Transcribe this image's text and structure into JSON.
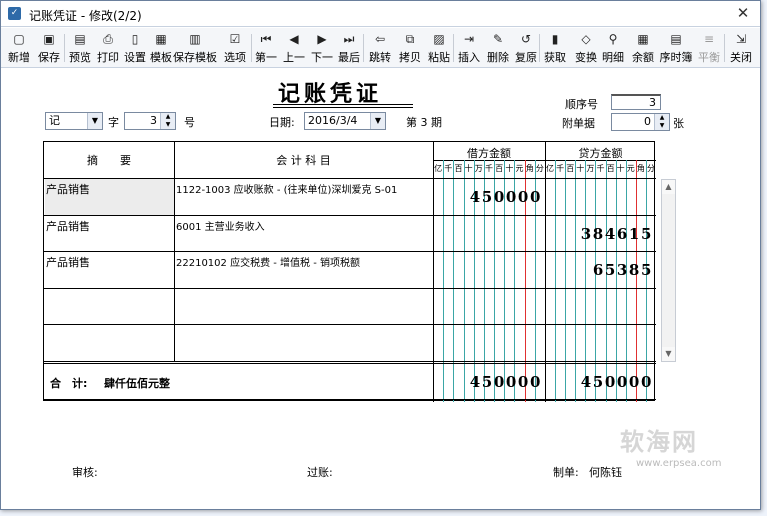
{
  "window": {
    "title": "记账凭证 - 修改(2/2)",
    "close_glyph": "✕"
  },
  "toolbar": {
    "buttons": [
      {
        "label": "新增",
        "icon": "new-icon",
        "glyph": "▢"
      },
      {
        "label": "保存",
        "icon": "save-icon",
        "glyph": "▣"
      },
      {
        "label": "预览",
        "icon": "preview-icon",
        "glyph": "▤"
      },
      {
        "label": "打印",
        "icon": "print-icon",
        "glyph": "⎙"
      },
      {
        "label": "设置",
        "icon": "settings-icon",
        "glyph": "▯"
      },
      {
        "label": "模板",
        "icon": "template-icon",
        "glyph": "▦"
      },
      {
        "label": "保存模板",
        "icon": "save-template-icon",
        "glyph": "▥"
      },
      {
        "label": "选项",
        "icon": "options-icon",
        "glyph": "☑"
      },
      {
        "label": "第一",
        "icon": "first-icon",
        "glyph": "⏮"
      },
      {
        "label": "上一",
        "icon": "prev-icon",
        "glyph": "◀"
      },
      {
        "label": "下一",
        "icon": "next-icon",
        "glyph": "▶"
      },
      {
        "label": "最后",
        "icon": "last-icon",
        "glyph": "⏭"
      },
      {
        "label": "跳转",
        "icon": "jump-icon",
        "glyph": "⇦"
      },
      {
        "label": "拷贝",
        "icon": "copy-icon",
        "glyph": "⧉"
      },
      {
        "label": "粘贴",
        "icon": "paste-icon",
        "glyph": "▨"
      },
      {
        "label": "插入",
        "icon": "insert-icon",
        "glyph": "⇥"
      },
      {
        "label": "删除",
        "icon": "delete-icon",
        "glyph": "✎"
      },
      {
        "label": "复原",
        "icon": "restore-icon",
        "glyph": "↺"
      },
      {
        "label": "获取",
        "icon": "fetch-icon",
        "glyph": "▮"
      },
      {
        "label": "变换",
        "icon": "transform-icon",
        "glyph": "◇"
      },
      {
        "label": "明细",
        "icon": "detail-icon",
        "glyph": "⚲"
      },
      {
        "label": "余额",
        "icon": "balance-icon",
        "glyph": "▦"
      },
      {
        "label": "序时簿",
        "icon": "journal-icon",
        "glyph": "▤"
      },
      {
        "label": "平衡",
        "icon": "balance-check-icon",
        "glyph": "≡",
        "disabled": true
      },
      {
        "label": "关闭",
        "icon": "close-doc-icon",
        "glyph": "⇲"
      }
    ]
  },
  "voucher": {
    "title": "记账凭证",
    "word_type": "记",
    "zi_label": "字",
    "number": "3",
    "hao_label": "号",
    "date_label": "日期:",
    "date": "2016/3/4",
    "period": "第 3 期",
    "seq_label": "顺序号",
    "seq": "3",
    "attach_label": "附单据",
    "attach": "0",
    "zhang_label": "张",
    "headers": {
      "summary": "摘　　要",
      "account": "会 计 科 目",
      "debit": "借方金额",
      "credit": "贷方金额",
      "digits": [
        "亿",
        "千",
        "百",
        "十",
        "万",
        "千",
        "百",
        "十",
        "元",
        "角",
        "分"
      ]
    },
    "rows": [
      {
        "summary": "产品销售",
        "account": "1122-1003 应收账款 - (往来单位)深圳爱克 S-01",
        "debit": "450000",
        "credit": ""
      },
      {
        "summary": "产品销售",
        "account": "6001 主营业务收入",
        "debit": "",
        "credit": "384615"
      },
      {
        "summary": "产品销售",
        "account": "22210102 应交税费 - 增值税 - 销项税额",
        "debit": "",
        "credit": "65385"
      },
      {
        "summary": "",
        "account": "",
        "debit": "",
        "credit": ""
      },
      {
        "summary": "",
        "account": "",
        "debit": "",
        "credit": ""
      }
    ],
    "total_label": "合　计:",
    "total_words": "肆仟伍佰元整",
    "total_debit": "450000",
    "total_credit": "450000",
    "audit_label": "审核:",
    "post_label": "过账:",
    "maker_label": "制单:",
    "maker": "何陈钰"
  },
  "watermark": {
    "text": "软海网",
    "url": "www.erpsea.com"
  }
}
